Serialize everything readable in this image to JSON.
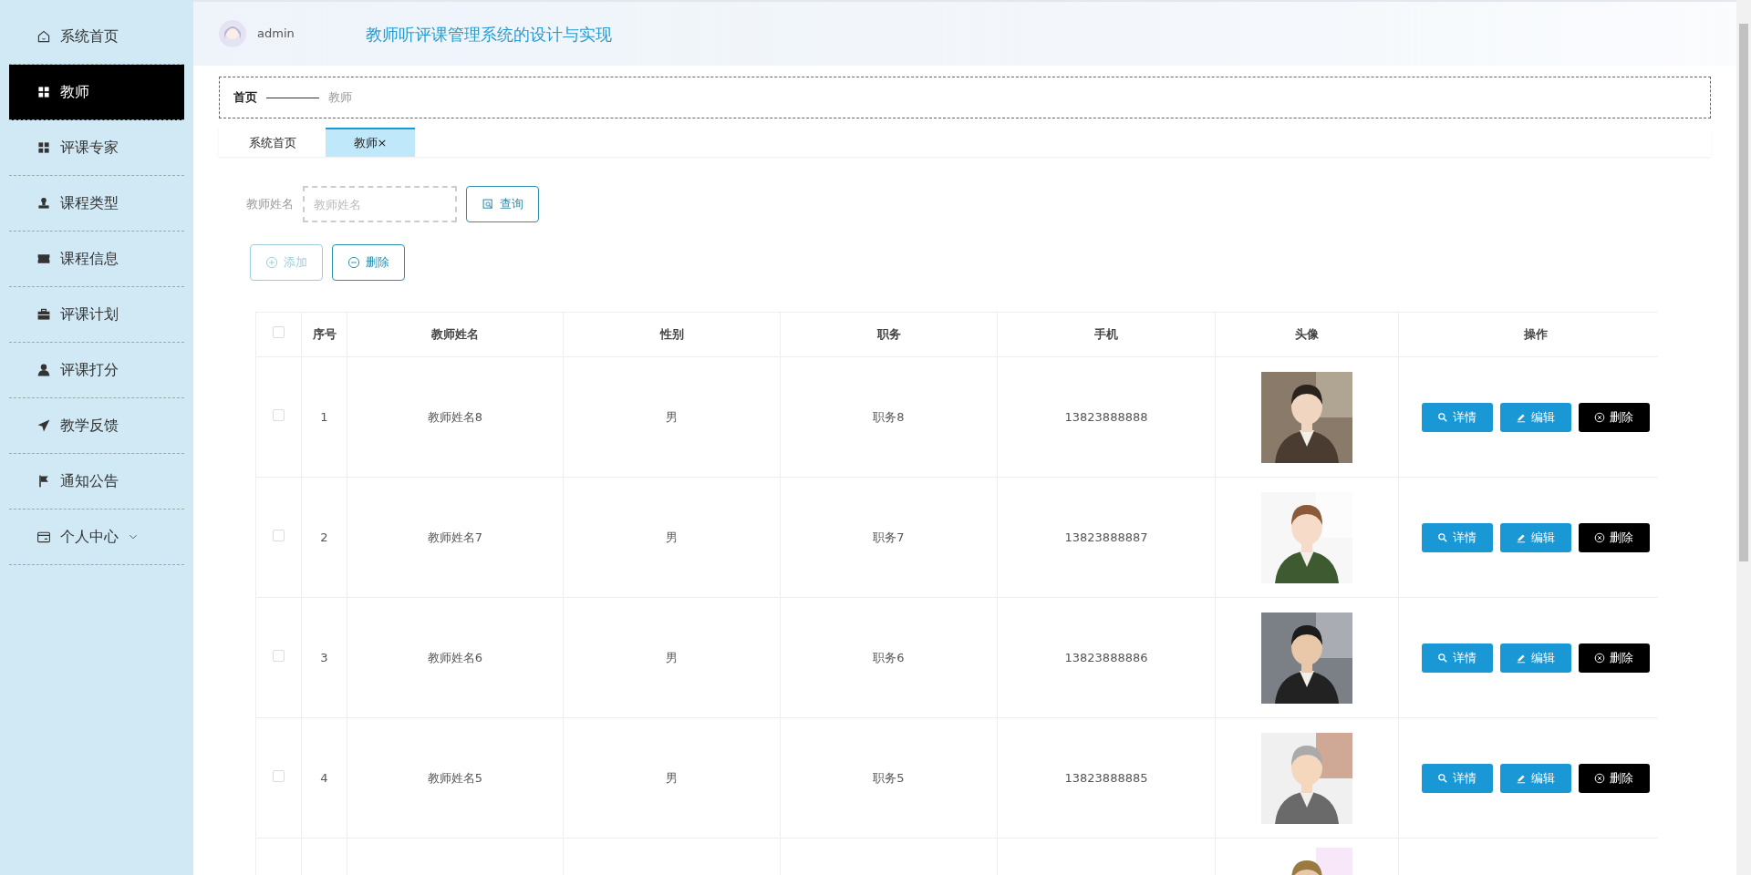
{
  "sidebar": {
    "items": [
      {
        "label": "系统首页",
        "kind": "home",
        "selected": false
      },
      {
        "label": "教师",
        "kind": "grid",
        "selected": true
      },
      {
        "label": "评课专家",
        "kind": "grid",
        "selected": false
      },
      {
        "label": "课程类型",
        "kind": "stamp",
        "selected": false
      },
      {
        "label": "课程信息",
        "kind": "ticket",
        "selected": false
      },
      {
        "label": "评课计划",
        "kind": "briefcase",
        "selected": false
      },
      {
        "label": "评课打分",
        "kind": "person",
        "selected": false
      },
      {
        "label": "教学反馈",
        "kind": "plane",
        "selected": false
      },
      {
        "label": "通知公告",
        "kind": "flag",
        "selected": false
      },
      {
        "label": "个人中心",
        "kind": "card",
        "selected": false,
        "expanded": false
      }
    ]
  },
  "header": {
    "user": "admin",
    "title": "教师听评课管理系统的设计与实现"
  },
  "breadcrumb": [
    {
      "label": "首页",
      "current": false
    },
    {
      "label": "教师",
      "current": true
    }
  ],
  "tabs": [
    {
      "label": "系统首页",
      "selected": false
    },
    {
      "label": "教师",
      "close": "×",
      "selected": true
    }
  ],
  "search": {
    "label": "教师姓名",
    "placeholder": "教师姓名",
    "button": "查询"
  },
  "actions": [
    {
      "label": "添加",
      "kind": "add",
      "disabled": true
    },
    {
      "label": "删除",
      "kind": "delete",
      "disabled": false
    }
  ],
  "table": {
    "select_all": {
      "checked": false
    },
    "columns": [
      "序号",
      "教师姓名",
      "性别",
      "职务",
      "手机",
      "头像",
      "操作"
    ],
    "rows": [
      {
        "checked": false,
        "index": "1",
        "name": "教师姓名8",
        "gender": "男",
        "position": "职务8",
        "phone": "13823888888",
        "avatar": {
          "kind": "picture"
        },
        "buttons": [
          {
            "label": "详情",
            "kind": "detail"
          },
          {
            "label": "编辑",
            "kind": "edit"
          },
          {
            "label": "删除",
            "kind": "delete"
          }
        ]
      },
      {
        "checked": false,
        "index": "2",
        "name": "教师姓名7",
        "gender": "男",
        "position": "职务7",
        "phone": "13823888887",
        "avatar": {
          "kind": "picture"
        },
        "buttons": [
          {
            "label": "详情",
            "kind": "detail"
          },
          {
            "label": "编辑",
            "kind": "edit"
          },
          {
            "label": "删除",
            "kind": "delete"
          }
        ]
      },
      {
        "checked": false,
        "index": "3",
        "name": "教师姓名6",
        "gender": "男",
        "position": "职务6",
        "phone": "13823888886",
        "avatar": {
          "kind": "picture"
        },
        "buttons": [
          {
            "label": "详情",
            "kind": "detail"
          },
          {
            "label": "编辑",
            "kind": "edit"
          },
          {
            "label": "删除",
            "kind": "delete"
          }
        ]
      },
      {
        "checked": false,
        "index": "4",
        "name": "教师姓名5",
        "gender": "男",
        "position": "职务5",
        "phone": "13823888885",
        "avatar": {
          "kind": "picture"
        },
        "buttons": [
          {
            "label": "详情",
            "kind": "detail"
          },
          {
            "label": "编辑",
            "kind": "edit"
          },
          {
            "label": "删除",
            "kind": "delete"
          }
        ]
      },
      {
        "avatar": {
          "kind": "picture"
        }
      }
    ]
  }
}
